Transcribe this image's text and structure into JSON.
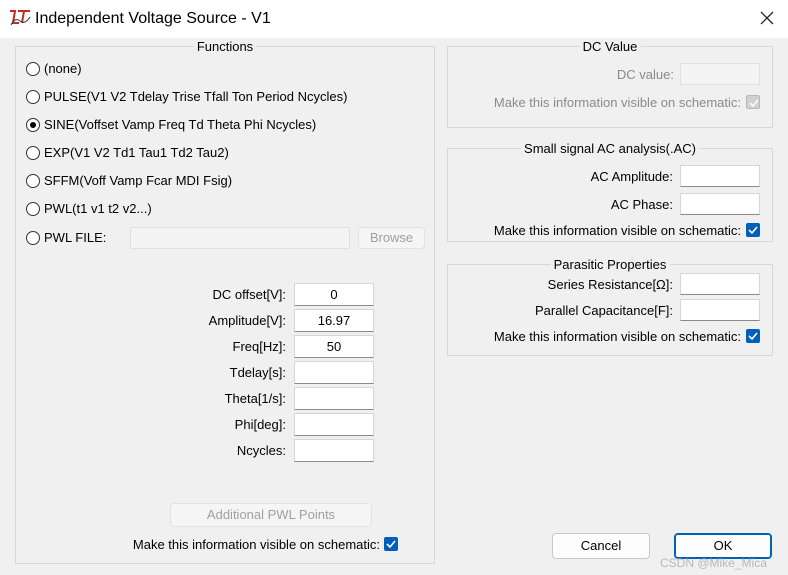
{
  "window": {
    "title": "Independent Voltage Source - V1"
  },
  "functions": {
    "legend": "Functions",
    "options": [
      {
        "label": "(none)",
        "selected": false
      },
      {
        "label": "PULSE(V1 V2 Tdelay Trise Tfall Ton Period Ncycles)",
        "selected": false
      },
      {
        "label": "SINE(Voffset Vamp Freq Td Theta Phi Ncycles)",
        "selected": true
      },
      {
        "label": "EXP(V1 V2 Td1 Tau1 Td2 Tau2)",
        "selected": false
      },
      {
        "label": "SFFM(Voff Vamp Fcar MDI Fsig)",
        "selected": false
      },
      {
        "label": "PWL(t1 v1 t2 v2...)",
        "selected": false
      },
      {
        "label": "PWL FILE:",
        "selected": false
      }
    ],
    "browse_label": "Browse",
    "params": [
      {
        "label": "DC offset[V]:",
        "value": "0"
      },
      {
        "label": "Amplitude[V]:",
        "value": "16.97"
      },
      {
        "label": "Freq[Hz]:",
        "value": "50"
      },
      {
        "label": "Tdelay[s]:",
        "value": ""
      },
      {
        "label": "Theta[1/s]:",
        "value": ""
      },
      {
        "label": "Phi[deg]:",
        "value": ""
      },
      {
        "label": "Ncycles:",
        "value": ""
      }
    ],
    "additional_pwl_label": "Additional PWL Points",
    "visible_label": "Make this information visible on schematic:",
    "visible_checked": true
  },
  "dc_value": {
    "legend": "DC Value",
    "label": "DC value:",
    "value": "",
    "visible_label": "Make this information visible on schematic:",
    "visible_checked": true
  },
  "ac": {
    "legend": "Small signal AC analysis(.AC)",
    "amplitude_label": "AC Amplitude:",
    "amplitude_value": "",
    "phase_label": "AC Phase:",
    "phase_value": "",
    "visible_label": "Make this information visible on schematic:",
    "visible_checked": true
  },
  "parasitic": {
    "legend": "Parasitic Properties",
    "series_label": "Series Resistance[Ω]:",
    "series_value": "",
    "parallel_label": "Parallel Capacitance[F]:",
    "parallel_value": "",
    "visible_label": "Make this information visible on schematic:",
    "visible_checked": true
  },
  "buttons": {
    "cancel": "Cancel",
    "ok": "OK"
  },
  "watermark": "CSDN @Mike_Mica",
  "colors": {
    "accent": "#005fb8",
    "background": "#f0f0f0"
  }
}
